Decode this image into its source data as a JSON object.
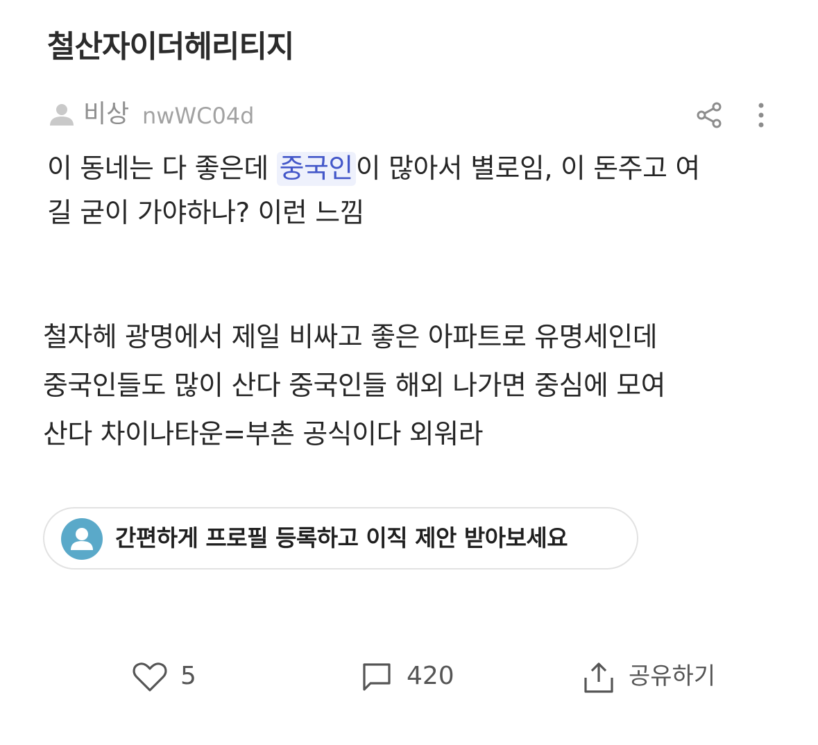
{
  "post": {
    "title": "철산자이더헤리티지",
    "author": {
      "name": "비상",
      "id": "nwWC04d"
    },
    "quote": {
      "line1_before": "이 동네는 다 좋은데 ",
      "line1_highlight": "중국인",
      "line1_after": "이 많아서 별로임, 이 돈주고 여",
      "line2": "길 굳이 가야하나? 이런 느낌"
    },
    "body_lines": [
      "철자헤 광명에서 제일 비싸고 좋은 아파트로 유명세인데",
      "중국인들도 많이 산다 중국인들 해외 나가면 중심에 모여",
      "산다 차이나타운=부촌 공식이다 외워라"
    ]
  },
  "cta": {
    "label": "간편하게 프로필 등록하고 이직 제안 받아보세요"
  },
  "actions": {
    "likes": "5",
    "comments": "420",
    "share_label": "공유하기"
  },
  "icons": {
    "author_avatar": "person-icon",
    "share_top": "share-icon",
    "more": "more-vertical-icon",
    "cta_avatar": "person-circle-icon",
    "like": "heart-icon",
    "comment": "comment-icon",
    "share": "upload-share-icon"
  },
  "colors": {
    "highlight_text": "#4357c9",
    "highlight_bg": "#eef1fc",
    "cta_avatar": "#5aa9c9",
    "muted": "#8f8f8f"
  }
}
